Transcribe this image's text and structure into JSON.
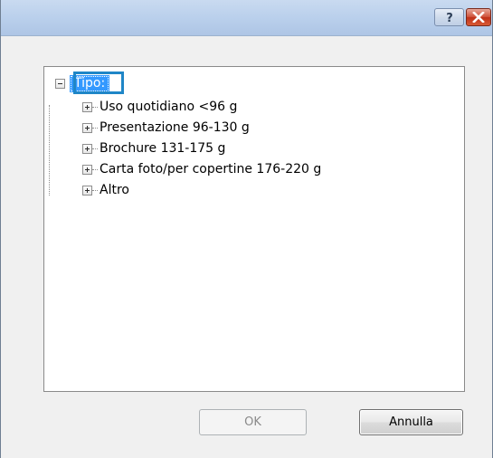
{
  "titlebar": {
    "help_label": "?",
    "close_icon": "close-icon",
    "help_icon": "help-icon"
  },
  "tree": {
    "root": {
      "label": "Tipo:",
      "state": "expanded",
      "selected": true
    },
    "children": [
      {
        "label": "Uso quotidiano <96 g",
        "state": "collapsed"
      },
      {
        "label": "Presentazione 96-130 g",
        "state": "collapsed"
      },
      {
        "label": "Brochure 131-175 g",
        "state": "collapsed"
      },
      {
        "label": "Carta foto/per copertine 176-220 g",
        "state": "collapsed"
      },
      {
        "label": "Altro",
        "state": "collapsed"
      }
    ]
  },
  "buttons": {
    "ok_label": "OK",
    "ok_enabled": false,
    "cancel_label": "Annulla"
  },
  "colors": {
    "selection": "#3399ff",
    "highlight_frame": "#1f86c7",
    "close_button": "#c9412a"
  }
}
